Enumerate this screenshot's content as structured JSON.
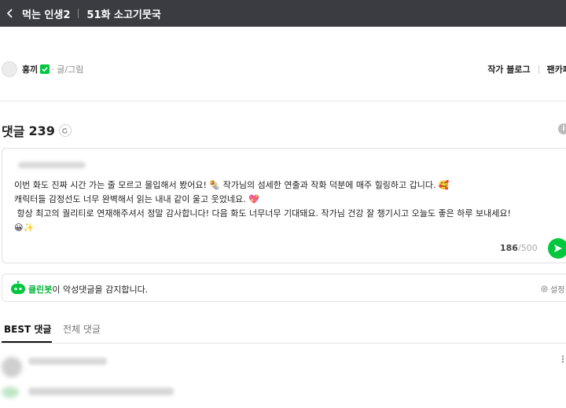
{
  "header": {
    "back_icon": "chevron-left-icon",
    "series_title": "먹는 인생2",
    "episode_title": "51화 소고기뭇국"
  },
  "author": {
    "name": "홍끼",
    "verified_icon": "verified-check-icon",
    "role": "· 글/그림",
    "blog_link": "작가 블로그",
    "fan_link": "팬카페"
  },
  "comments": {
    "title": "댓글",
    "count": "239",
    "refresh_icon": "refresh-icon",
    "info_icon": "info-icon"
  },
  "draft": {
    "text": "이번 화도 진짜 시간 가는 줄 모르고 몰입해서 봤어요! 🌯 작가님의 섬세한 연출과 작화 덕분에 매주 힐링하고 갑니다. 🥰\n캐릭터들 감정선도 너무 완벽해서 읽는 내내 같이 울고 웃었네요. 💖\n 항상 최고의 퀄리티로 연재해주셔서 정말 감사합니다! 다음 화도 너무너무 기대돼요. 작가님 건강 잘 챙기시고 오늘도 좋은 하루 보내세요!\n😀✨",
    "char_count": "186",
    "char_separator": "/",
    "char_max": "500",
    "send_icon": "send-icon"
  },
  "cleanbot": {
    "brand": "클린봇",
    "message": "이 악성댓글을 감지합니다.",
    "settings_label": "설정",
    "bot_icon": "cleanbot-icon",
    "settings_icon": "gear-icon"
  },
  "tabs": {
    "best": "BEST 댓글",
    "all": "전체 댓글"
  },
  "colors": {
    "accent": "#00c73c",
    "topbar": "#3a3c42"
  }
}
